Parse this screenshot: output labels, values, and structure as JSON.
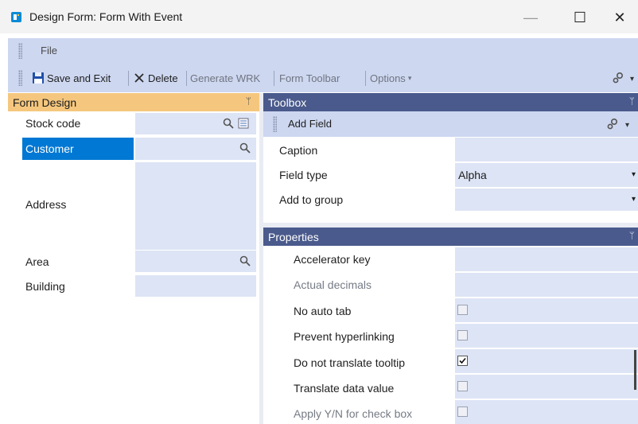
{
  "window": {
    "title": "Design Form: Form With Event",
    "min_glyph": "—",
    "max_glyph": "☐",
    "close_glyph": "✕"
  },
  "menu": {
    "file": "File"
  },
  "toolbar": {
    "save_exit": "Save and Exit",
    "delete": "Delete",
    "generate_wrk": "Generate WRK",
    "form_toolbar": "Form Toolbar",
    "options": "Options",
    "options_arrow": "▾"
  },
  "form_design": {
    "title": "Form Design",
    "pin": "ᛘ",
    "fields": [
      {
        "label": "Stock code"
      },
      {
        "label": "Customer"
      },
      {
        "label": "Address"
      },
      {
        "label": "Area"
      },
      {
        "label": "Building"
      }
    ]
  },
  "toolbox": {
    "title": "Toolbox",
    "pin": "ᛘ",
    "add_field": "Add Field",
    "rows": [
      {
        "label": "Caption",
        "value": ""
      },
      {
        "label": "Field type",
        "value": "Alpha",
        "arrow": "▾"
      },
      {
        "label": "Add to group",
        "value": "",
        "arrow": "▾"
      }
    ]
  },
  "properties": {
    "title": "Properties",
    "pin": "ᛘ",
    "rows": [
      {
        "label": "Accelerator key",
        "type": "text",
        "disabled": false,
        "checked": false
      },
      {
        "label": "Actual decimals",
        "type": "text",
        "disabled": true,
        "checked": false
      },
      {
        "label": "No auto tab",
        "type": "check",
        "disabled": false,
        "checked": false
      },
      {
        "label": "Prevent hyperlinking",
        "type": "check",
        "disabled": false,
        "checked": false
      },
      {
        "label": "Do not translate tooltip",
        "type": "check",
        "disabled": false,
        "checked": true
      },
      {
        "label": "Translate data value",
        "type": "check",
        "disabled": false,
        "checked": false
      },
      {
        "label": "Apply Y/N for check box",
        "type": "check",
        "disabled": true,
        "checked": false
      }
    ]
  },
  "colors": {
    "accent": "#0078d4",
    "form_design_header": "#f5c77e",
    "panel_header": "#4a5a8c",
    "toolbar_bg": "#cdd7f0",
    "field_bg": "#dde4f5"
  }
}
